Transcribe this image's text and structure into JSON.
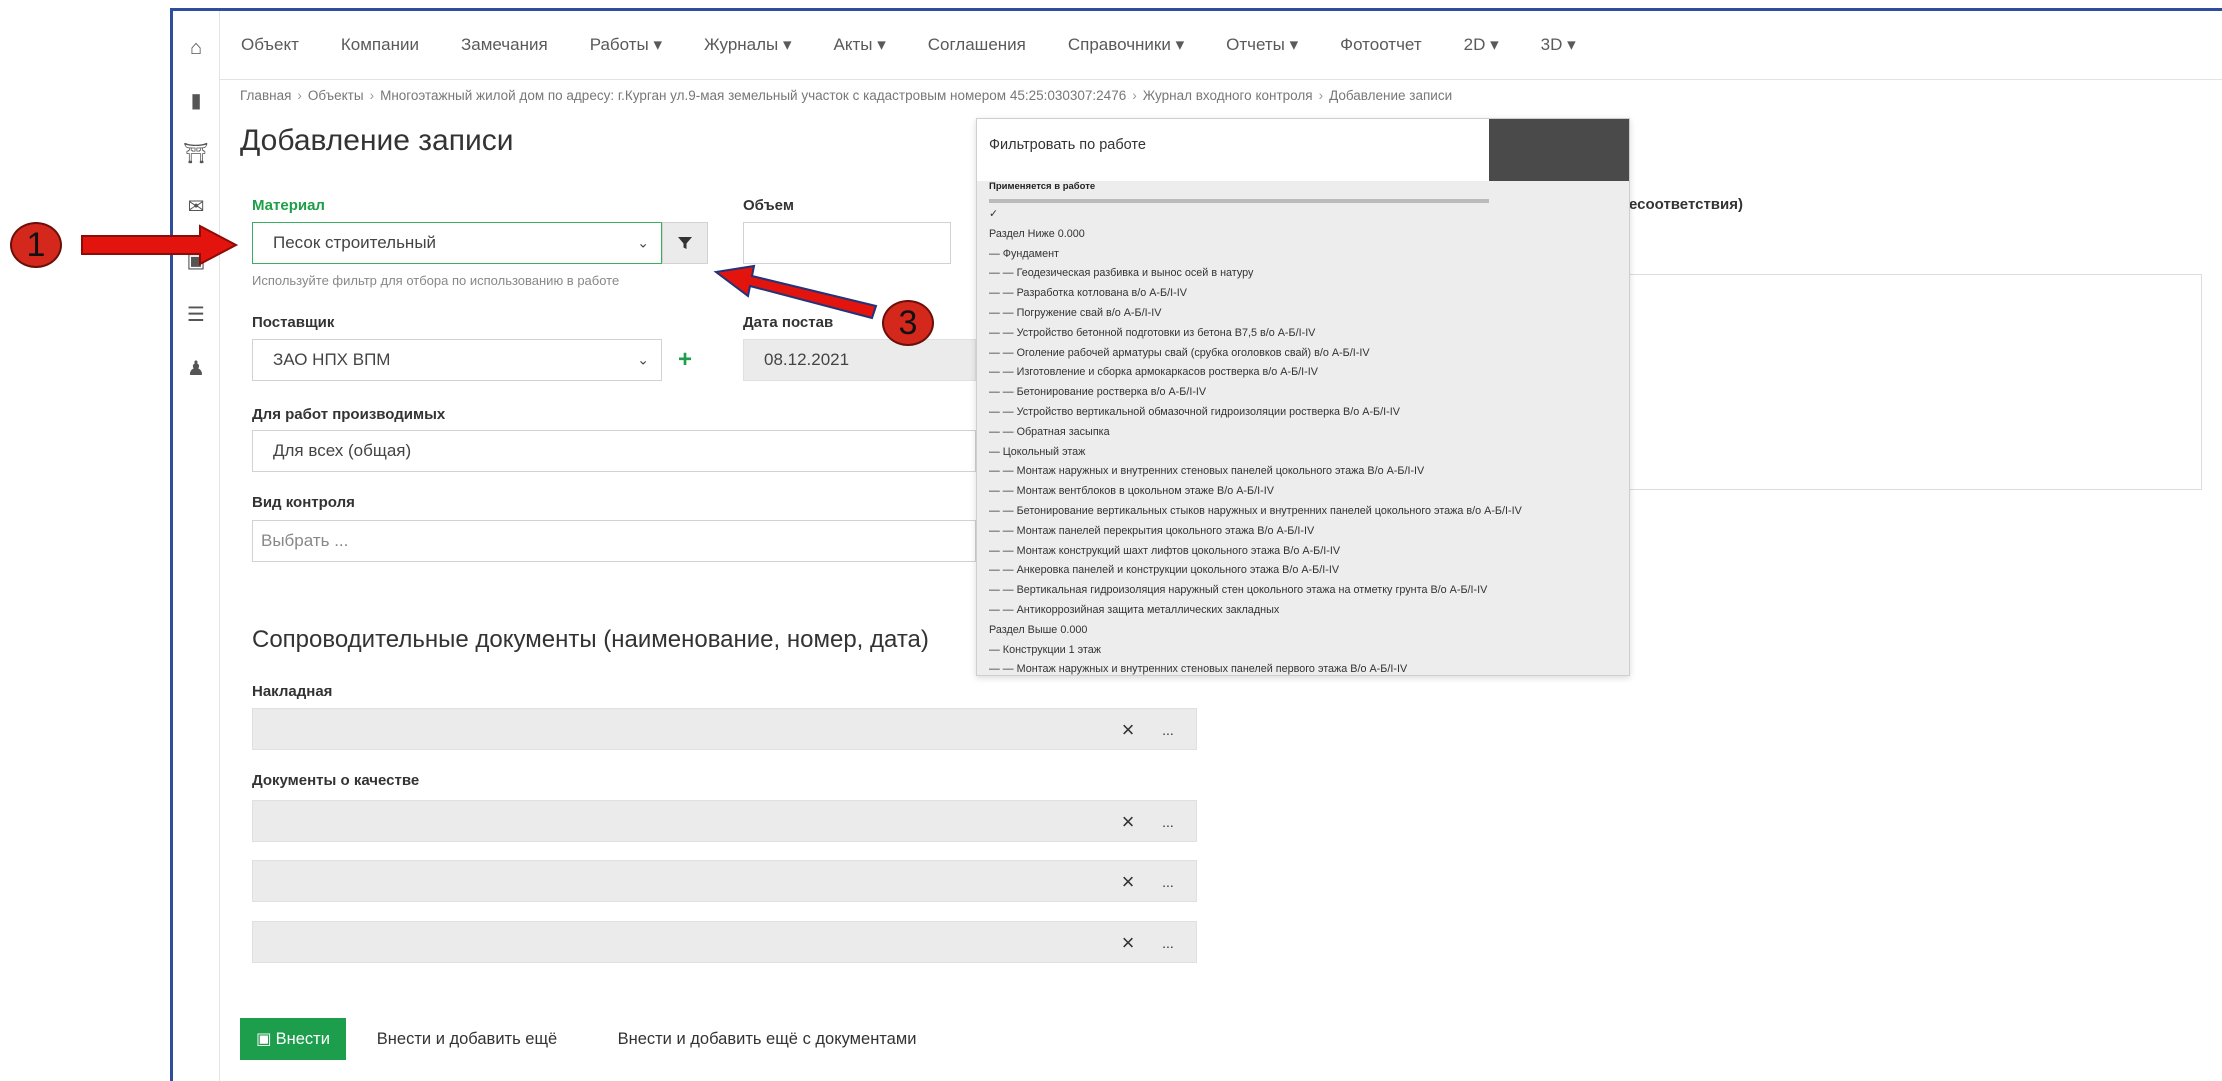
{
  "nav": {
    "items": [
      "Объект",
      "Компании",
      "Замечания",
      "Работы ▾",
      "Журналы ▾",
      "Акты ▾",
      "Соглашения",
      "Справочники ▾",
      "Отчеты ▾",
      "Фотоотчет",
      "2D ▾",
      "3D ▾"
    ]
  },
  "breadcrumb": {
    "home": "Главная",
    "objects": "Объекты",
    "object": "Многоэтажный жилой дом по адресу: г.Курган ул.9-мая земельный участок с кадастровым номером 45:25:030307:2476",
    "journal": "Журнал входного контроля",
    "current": "Добавление записи"
  },
  "page": {
    "title": "Добавление записи"
  },
  "form": {
    "material_label": "Материал",
    "material_value": "Песок строительный",
    "material_hint": "Используйте фильтр для отбора по использованию в работе",
    "volume_label": "Объем",
    "supplier_label": "Поставщик",
    "supplier_value": "ЗАО НПХ ВПМ",
    "delivery_date_label": "Дата постав",
    "delivery_date_value": "08.12.2021",
    "works_label": "Для работ производимых",
    "works_value": "Для всех (общая)",
    "control_label": "Вид контроля",
    "control_placeholder": "Выбрать ..."
  },
  "right_panel": {
    "title_fragment": "есоответствия)"
  },
  "documents": {
    "section_title": "Сопроводительные документы (наименование, номер, дата)",
    "invoice_label": "Накладная",
    "quality_label": "Документы о качестве",
    "clear_symbol": "×",
    "browse_symbol": "..."
  },
  "buttons": {
    "submit": "Внести",
    "submit_add": "Внести и добавить ещё",
    "submit_add_docs": "Внести и добавить ещё с документами"
  },
  "filter_dropdown": {
    "title": "Фильтровать по работе",
    "subtitle": "Применяется в работе",
    "items": [
      "✓",
      "Раздел Ниже 0.000",
      "— Фундамент",
      "— — Геодезическая разбивка и вынос осей в натуру",
      "— — Разработка котлована в/о А-Б/I-IV",
      "— — Погружение свай в/о А-Б/I-IV",
      "— — Устройство бетонной подготовки из бетона В7,5 в/о А-Б/I-IV",
      "— — Оголение рабочей арматуры свай (срубка оголовков свай) в/о А-Б/I-IV",
      "— — Изготовление и сборка армокаркасов ростверка в/о А-Б/I-IV",
      "— — Бетонирование ростверка в/о А-Б/I-IV",
      "— — Устройство вертикальной обмазочной гидроизоляции ростверка В/о А-Б/I-IV",
      "— — Обратная засыпка",
      "— Цокольный этаж",
      "— — Монтаж наружных и внутренних стеновых панелей цокольного этажа В/о А-Б/I-IV",
      "— — Монтаж вентблоков в цокольном этаже В/о А-Б/I-IV",
      "— — Бетонирование вертикальных стыков наружных и внутренних панелей цокольного этажа в/о А-Б/I-IV",
      "— — Монтаж панелей перекрытия цокольного этажа В/о А-Б/I-IV",
      "— — Монтаж конструкций шахт лифтов цокольного этажа В/о А-Б/I-IV",
      "— — Анкеровка панелей и конструкции цокольного этажа В/о А-Б/I-IV",
      "— — Вертикальная гидроизоляция наружный стен цокольного этажа на отметку грунта В/о А-Б/I-IV",
      "— — Антикоррозийная защита металлических закладных",
      "Раздел Выше 0.000",
      "— Конструкции 1 этаж",
      "— — Монтаж наружных и внутренних стеновых панелей первого этажа В/о А-Б/I-IV"
    ]
  },
  "annotations": {
    "marker_1": "1",
    "marker_3": "3"
  },
  "colors": {
    "accent_green": "#1d9e4d",
    "arrow_red": "#e3130d",
    "frame_blue": "#2e4d9c"
  },
  "icons": {
    "sidebar": [
      "home-icon",
      "building-icon",
      "bank-icon",
      "envelope-icon",
      "image-icon",
      "list-icon",
      "users-icon"
    ],
    "filter": "filter-icon",
    "add": "plus-icon"
  }
}
